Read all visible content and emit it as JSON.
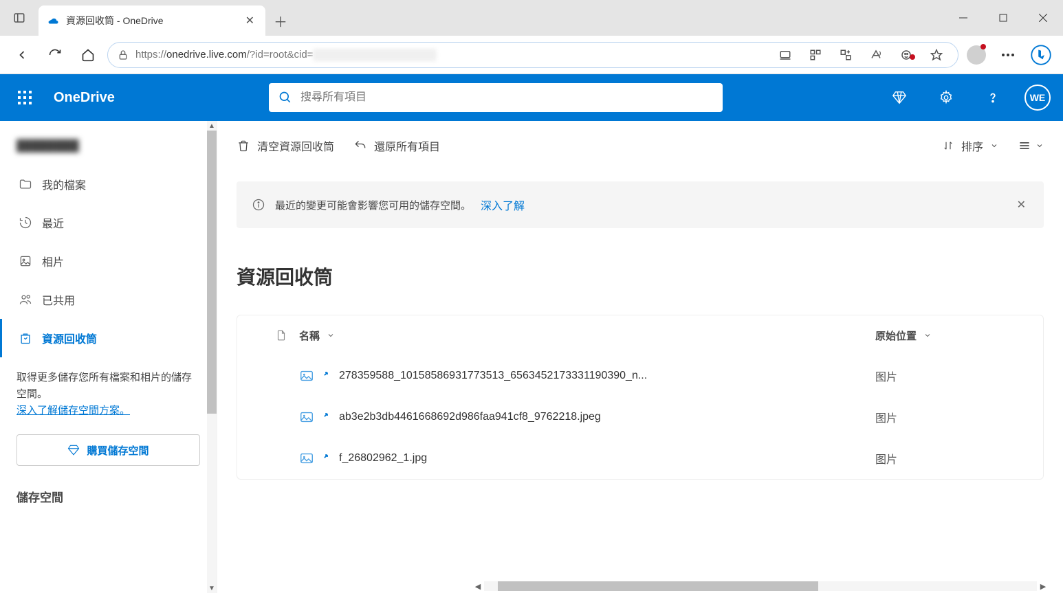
{
  "browser": {
    "tab_title": "資源回收筒 - OneDrive",
    "url_prefix": "https://",
    "url_host": "onedrive.live.com",
    "url_path": "/?id=root&cid="
  },
  "header": {
    "app_name": "OneDrive",
    "search_placeholder": "搜尋所有項目",
    "avatar_initials": "WE"
  },
  "sidebar": {
    "user_placeholder": "████████",
    "items": [
      {
        "icon": "folder",
        "label": "我的檔案"
      },
      {
        "icon": "clock",
        "label": "最近"
      },
      {
        "icon": "image",
        "label": "相片"
      },
      {
        "icon": "people",
        "label": "已共用"
      },
      {
        "icon": "recycle",
        "label": "資源回收筒",
        "active": true
      }
    ],
    "storage_promo": "取得更多儲存您所有檔案和相片的儲存空間。",
    "storage_link": "深入了解儲存空間方案。",
    "buy_button": "購買儲存空間",
    "storage_heading": "儲存空間"
  },
  "commands": {
    "empty": "清空資源回收筒",
    "restore": "還原所有項目",
    "sort": "排序"
  },
  "info": {
    "text": "最近的變更可能會影響您可用的儲存空間。",
    "link": "深入了解"
  },
  "page_title": "資源回收筒",
  "table": {
    "col_name": "名稱",
    "col_location": "原始位置",
    "rows": [
      {
        "name": "278359588_10158586931773513_6563452173331190390_n...",
        "location": "图片"
      },
      {
        "name": "ab3e2b3db4461668692d986faa941cf8_9762218.jpeg",
        "location": "图片"
      },
      {
        "name": "f_26802962_1.jpg",
        "location": "图片"
      }
    ]
  }
}
